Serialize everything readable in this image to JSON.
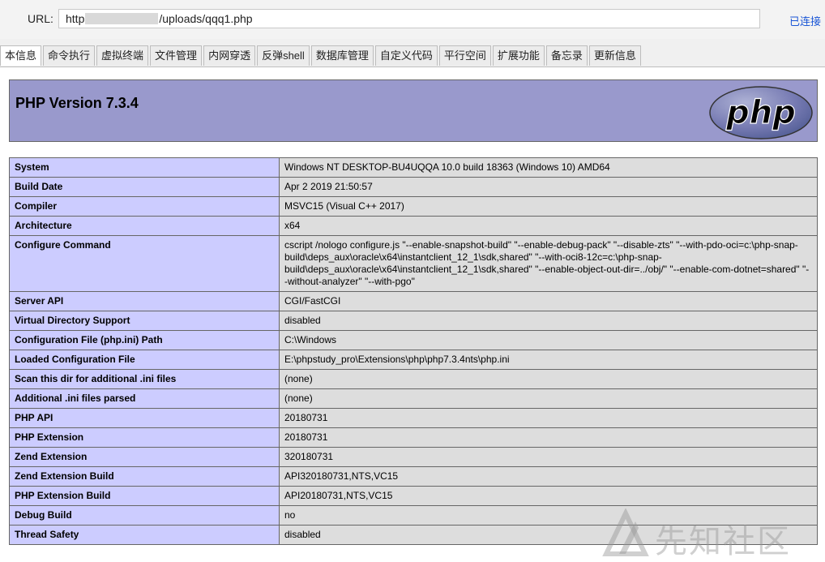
{
  "urlbar": {
    "label": "URL:",
    "url_prefix": "http",
    "url_suffix": "/uploads/qqq1.php",
    "status": "已连接"
  },
  "tabs": [
    {
      "label": "本信息",
      "active": true
    },
    {
      "label": "命令执行"
    },
    {
      "label": "虚拟终端"
    },
    {
      "label": "文件管理"
    },
    {
      "label": "内网穿透"
    },
    {
      "label": "反弹shell"
    },
    {
      "label": "数据库管理"
    },
    {
      "label": "自定义代码"
    },
    {
      "label": "平行空间"
    },
    {
      "label": "扩展功能"
    },
    {
      "label": "备忘录"
    },
    {
      "label": "更新信息"
    }
  ],
  "php": {
    "version_title": "PHP Version 7.3.4",
    "logo_text": "php"
  },
  "info_rows": [
    {
      "key": "System",
      "value": "Windows NT DESKTOP-BU4UQQA 10.0 build 18363 (Windows 10) AMD64"
    },
    {
      "key": "Build Date",
      "value": "Apr 2 2019 21:50:57"
    },
    {
      "key": "Compiler",
      "value": "MSVC15 (Visual C++ 2017)"
    },
    {
      "key": "Architecture",
      "value": "x64"
    },
    {
      "key": "Configure Command",
      "value": "cscript /nologo configure.js \"--enable-snapshot-build\" \"--enable-debug-pack\" \"--disable-zts\" \"--with-pdo-oci=c:\\php-snap-build\\deps_aux\\oracle\\x64\\instantclient_12_1\\sdk,shared\" \"--with-oci8-12c=c:\\php-snap-build\\deps_aux\\oracle\\x64\\instantclient_12_1\\sdk,shared\" \"--enable-object-out-dir=../obj/\" \"--enable-com-dotnet=shared\" \"--without-analyzer\" \"--with-pgo\""
    },
    {
      "key": "Server API",
      "value": "CGI/FastCGI"
    },
    {
      "key": "Virtual Directory Support",
      "value": "disabled"
    },
    {
      "key": "Configuration File (php.ini) Path",
      "value": "C:\\Windows"
    },
    {
      "key": "Loaded Configuration File",
      "value": "E:\\phpstudy_pro\\Extensions\\php\\php7.3.4nts\\php.ini"
    },
    {
      "key": "Scan this dir for additional .ini files",
      "value": "(none)"
    },
    {
      "key": "Additional .ini files parsed",
      "value": "(none)"
    },
    {
      "key": "PHP API",
      "value": "20180731"
    },
    {
      "key": "PHP Extension",
      "value": "20180731"
    },
    {
      "key": "Zend Extension",
      "value": "320180731"
    },
    {
      "key": "Zend Extension Build",
      "value": "API320180731,NTS,VC15"
    },
    {
      "key": "PHP Extension Build",
      "value": "API20180731,NTS,VC15"
    },
    {
      "key": "Debug Build",
      "value": "no"
    },
    {
      "key": "Thread Safety",
      "value": "disabled"
    }
  ],
  "watermark": {
    "text": "先知社区"
  },
  "colors": {
    "header_bg": "#9999cc",
    "key_bg": "#ccccff",
    "value_bg": "#dddddd",
    "link": "#1a56d6"
  }
}
